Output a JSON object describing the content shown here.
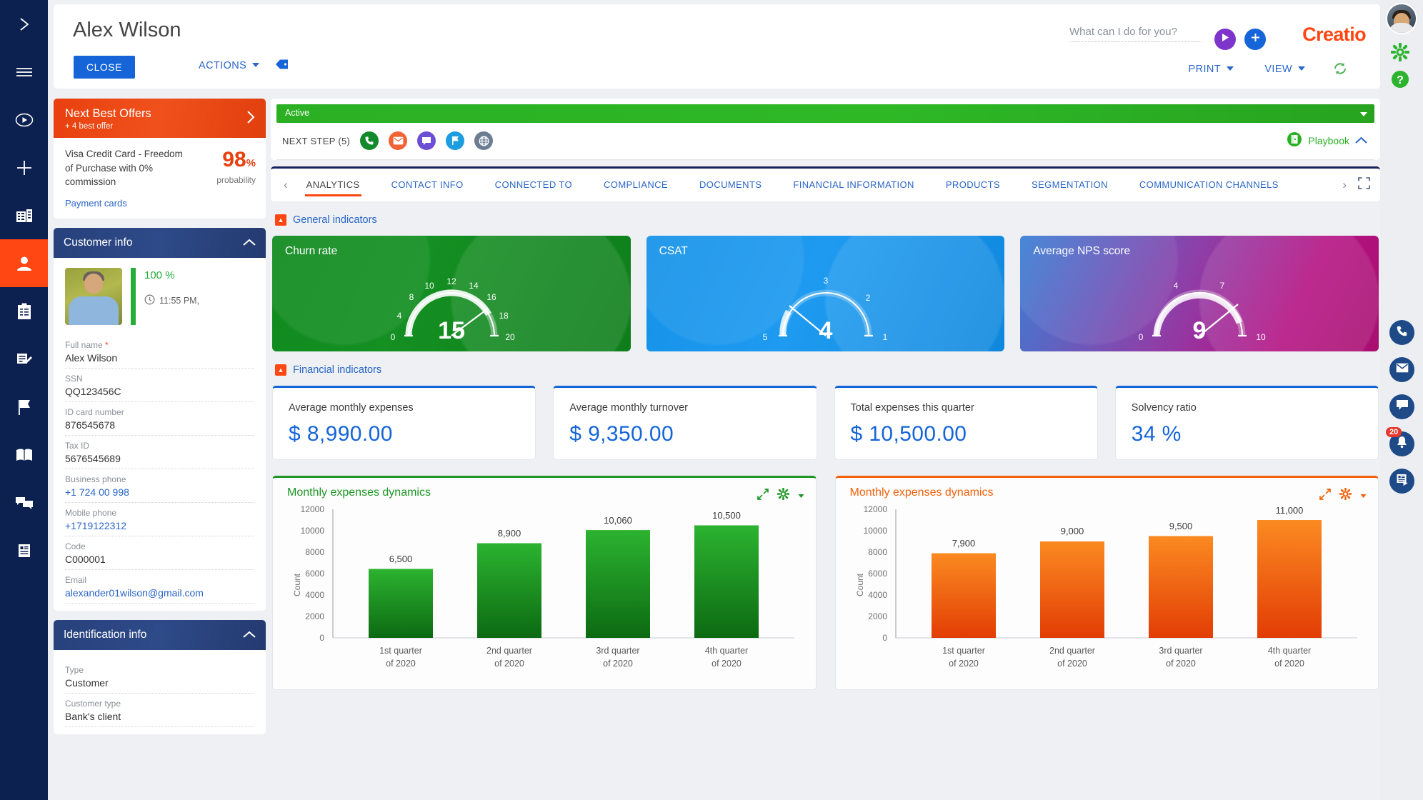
{
  "left_rail": {
    "items": [
      {
        "name": "expand-arrow-icon",
        "label": "Expand"
      },
      {
        "name": "menu-hamburger-icon",
        "label": "Menu"
      },
      {
        "name": "play-circle-icon",
        "label": "Run process"
      },
      {
        "name": "plus-icon",
        "label": "Add"
      },
      {
        "name": "building-icon",
        "label": "Accounts"
      },
      {
        "name": "person-icon",
        "label": "Contacts"
      },
      {
        "name": "clipboard-icon",
        "label": "Activities"
      },
      {
        "name": "document-edit-icon",
        "label": "Requests"
      },
      {
        "name": "flag-icon",
        "label": "Leads"
      },
      {
        "name": "book-icon",
        "label": "Knowledge base"
      },
      {
        "name": "chat-icon",
        "label": "Feed"
      },
      {
        "name": "article-icon",
        "label": "Reports"
      }
    ]
  },
  "header": {
    "title": "Alex Wilson",
    "close_label": "CLOSE",
    "actions_label": "ACTIONS",
    "tag_icon": "tag-icon",
    "print_label": "PRINT",
    "view_label": "VIEW",
    "brand": "Creatio",
    "refresh_icon": "refresh-icon",
    "run_icon": "play-icon",
    "add_icon": "plus-icon"
  },
  "search": {
    "placeholder": "What can I do for you?",
    "value": ""
  },
  "right_rail": {
    "avatar": "user-avatar",
    "settings_icon": "gear-icon",
    "help_icon": "help-circle-icon",
    "call_icon": "phone-icon",
    "email_icon": "envelope-icon",
    "chat_icon": "chat-bubble-icon",
    "notify_icon": "bell-icon",
    "notify_count": "20",
    "feed_icon": "feed-icon"
  },
  "next_best_offers": {
    "title": "Next Best Offers",
    "subtitle": "+ 4 best offer",
    "arrow_icon": "chevron-right-icon",
    "offer_name": "Visa Credit Card - Freedom of Purchase with 0% commission",
    "probability_value": "98",
    "probability_unit": "%",
    "probability_label": "probability",
    "link": "Payment cards"
  },
  "customer_info": {
    "title": "Customer info",
    "collapse_icon": "chevron-up-icon",
    "completeness": "100 %",
    "time": "11:55 PM,",
    "clock_icon": "clock-icon",
    "fields": [
      {
        "label": "Full name",
        "value": "Alex Wilson",
        "required": true,
        "link": false
      },
      {
        "label": "SSN",
        "value": "QQ123456C",
        "required": false,
        "link": false
      },
      {
        "label": "ID card number",
        "value": "876545678",
        "required": false,
        "link": false
      },
      {
        "label": "Tax ID",
        "value": "5676545689",
        "required": false,
        "link": false
      },
      {
        "label": "Business phone",
        "value": "+1 724 00 998",
        "required": false,
        "link": true
      },
      {
        "label": "Mobile phone",
        "value": "+1719122312",
        "required": false,
        "link": true
      },
      {
        "label": "Code",
        "value": "C000001",
        "required": false,
        "link": false
      },
      {
        "label": "Email",
        "value": "alexander01wilson@gmail.com",
        "required": false,
        "link": true
      }
    ]
  },
  "identification_info": {
    "title": "Identification info",
    "collapse_icon": "chevron-up-icon",
    "fields": [
      {
        "label": "Type",
        "value": "Customer"
      },
      {
        "label": "Customer type",
        "value": "Bank's client"
      }
    ]
  },
  "status": {
    "label": "Active",
    "caret_icon": "caret-down-icon"
  },
  "next_step": {
    "label": "NEXT STEP (5)",
    "icons": [
      {
        "name": "phone-step-icon",
        "color": "#128a2b"
      },
      {
        "name": "email-step-icon",
        "color": "#f26334"
      },
      {
        "name": "message-step-icon",
        "color": "#6d4fd6"
      },
      {
        "name": "flag-step-icon",
        "color": "#1b9de0"
      },
      {
        "name": "globe-step-icon",
        "color": "#6b7c93"
      }
    ],
    "playbook_label": "Playbook",
    "playbook_icon": "playbook-icon",
    "playbook_chevron": "chevron-up-icon"
  },
  "tabs": {
    "prev_icon": "chevron-left-icon",
    "next_icon": "chevron-right-icon",
    "expand_icon": "fullscreen-icon",
    "items": [
      {
        "label": "ANALYTICS",
        "active": true
      },
      {
        "label": "CONTACT INFO",
        "active": false
      },
      {
        "label": "CONNECTED TO",
        "active": false
      },
      {
        "label": "COMPLIANCE",
        "active": false
      },
      {
        "label": "DOCUMENTS",
        "active": false
      },
      {
        "label": "FINANCIAL INFORMATION",
        "active": false
      },
      {
        "label": "PRODUCTS",
        "active": false
      },
      {
        "label": "SEGMENTATION",
        "active": false
      },
      {
        "label": "COMMUNICATION CHANNELS",
        "active": false
      }
    ]
  },
  "sections": {
    "general_indicators": "General indicators",
    "financial_indicators": "Financial indicators",
    "toggle_icon": "collapse-caret-icon"
  },
  "financial_cards": [
    {
      "label": "Average monthly expenses",
      "value": "$ 8,990.00"
    },
    {
      "label": "Average monthly turnover",
      "value": "$ 9,350.00"
    },
    {
      "label": "Total expenses this quarter",
      "value": "$ 10,500.00"
    },
    {
      "label": "Solvency ratio",
      "value": "34 %"
    }
  ],
  "chart_tools": {
    "expand_icon": "expand-diagonal-icon",
    "gear_icon": "gear-icon",
    "caret_icon": "caret-down-icon"
  },
  "chart_data": [
    {
      "type": "gauge",
      "title": "Churn rate",
      "value": 15,
      "min": 0,
      "max": 20,
      "ticks": [
        0,
        4,
        8,
        10,
        12,
        14,
        16,
        18,
        20
      ],
      "reversed": false,
      "color": "#0f8a1e"
    },
    {
      "type": "gauge",
      "title": "CSAT",
      "value": 4,
      "min": 1,
      "max": 5,
      "ticks": [
        5,
        3,
        2,
        1
      ],
      "reversed": true,
      "color": "#1592e8"
    },
    {
      "type": "gauge",
      "title": "Average NPS score",
      "value": 9,
      "min": 0,
      "max": 10,
      "ticks": [
        0,
        4,
        7,
        10
      ],
      "reversed": false,
      "color": "#b41283"
    },
    {
      "type": "bar",
      "title": "Monthly expenses dynamics",
      "categories": [
        "1st quarter of 2020",
        "2nd quarter of 2020",
        "3rd quarter of 2020",
        "4th quarter of 2020"
      ],
      "values": [
        6500,
        8900,
        10060,
        10500
      ],
      "value_labels": [
        "6,500",
        "8,900",
        "10,060",
        "10,500"
      ],
      "ylabel": "Count",
      "xlabel": "",
      "ylim": [
        0,
        12000
      ],
      "yticks": [
        0,
        2000,
        4000,
        6000,
        8000,
        10000,
        12000
      ],
      "color": "#1e9625",
      "grid": false
    },
    {
      "type": "bar",
      "title": "Monthly expenses dynamics",
      "categories": [
        "1st quarter of 2020",
        "2nd quarter of 2020",
        "3rd quarter of 2020",
        "4th quarter of 2020"
      ],
      "values": [
        7900,
        9000,
        9500,
        11000
      ],
      "value_labels": [
        "7,900",
        "9,000",
        "9,500",
        "11,000"
      ],
      "ylabel": "Count",
      "xlabel": "",
      "ylim": [
        0,
        12000
      ],
      "yticks": [
        0,
        2000,
        4000,
        6000,
        8000,
        10000,
        12000
      ],
      "color": "#f2610c",
      "grid": false
    }
  ]
}
